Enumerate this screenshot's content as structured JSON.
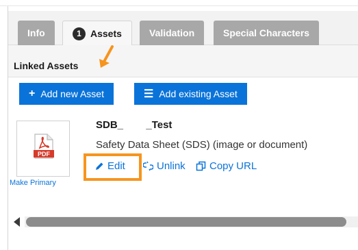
{
  "tabs": [
    {
      "label": "Info"
    },
    {
      "label": "Assets",
      "badge": "1"
    },
    {
      "label": "Validation"
    },
    {
      "label": "Special Characters"
    }
  ],
  "section": {
    "title": "Linked Assets"
  },
  "buttons": {
    "add_new": {
      "label": "Add new Asset",
      "icon": "plus-icon"
    },
    "add_existing": {
      "label": "Add existing Asset",
      "icon": "list-icon"
    }
  },
  "asset": {
    "name": "SDB_        _Test",
    "description": "Safety Data Sheet (SDS) (image or document)",
    "file_badge": "PDF",
    "make_primary": "Make Primary"
  },
  "actions": {
    "edit": "Edit",
    "unlink": "Unlink",
    "copy_url": "Copy URL"
  },
  "colors": {
    "accent": "#0a73d9",
    "highlight": "#f7941d",
    "tab_inactive": "#a8a8a8"
  }
}
